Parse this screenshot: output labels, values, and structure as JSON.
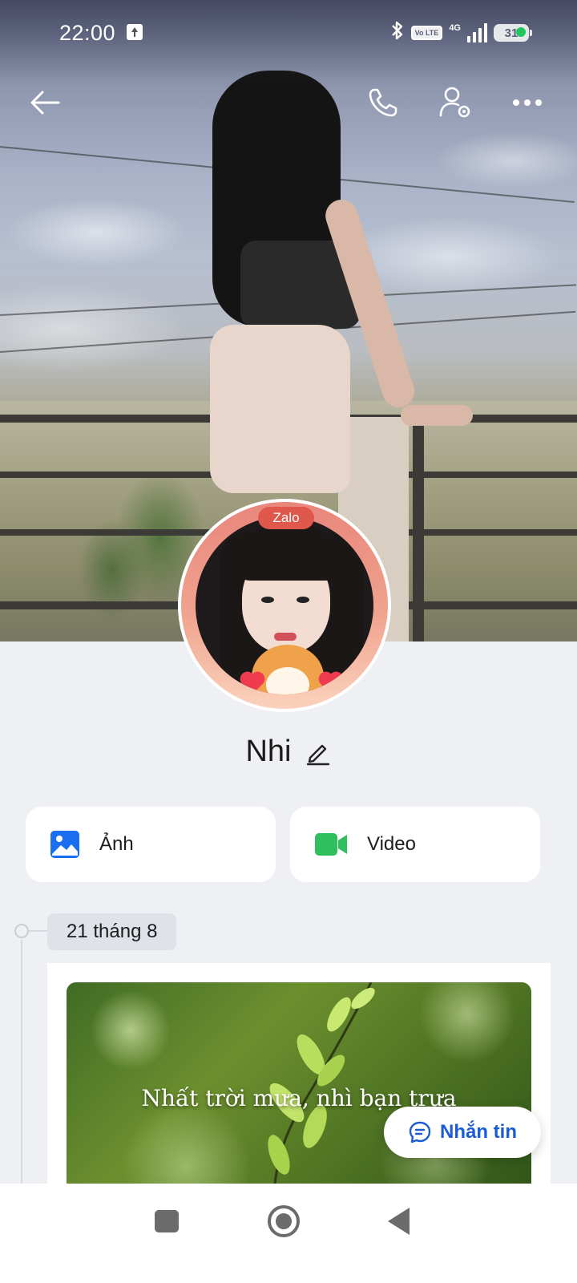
{
  "status_bar": {
    "time": "22:00",
    "network": "4G",
    "volte": "Vo LTE",
    "battery": "31",
    "icons": [
      "upload-icon",
      "bluetooth-icon",
      "volte-icon",
      "signal-icon",
      "battery-icon",
      "active-dot"
    ]
  },
  "top_bar": {
    "icons": [
      "back-arrow-icon",
      "phone-icon",
      "profile-settings-icon",
      "more-icon"
    ]
  },
  "avatar": {
    "badge": "Zalo",
    "ring_color": "#e9867c"
  },
  "profile": {
    "name": "Nhi"
  },
  "media": {
    "photos_label": "Ảnh",
    "videos_label": "Video",
    "photos_icon_color": "#1a6ff0",
    "videos_icon_color": "#2fbf5f"
  },
  "timeline": {
    "date": "21 tháng 8",
    "post_caption": "Nhất trời mưa, nhì bạn trưa"
  },
  "fab": {
    "label": "Nhắn tin",
    "color": "#1a5bd6"
  },
  "nav": {
    "icons": [
      "recents-icon",
      "home-icon",
      "back-icon"
    ]
  }
}
